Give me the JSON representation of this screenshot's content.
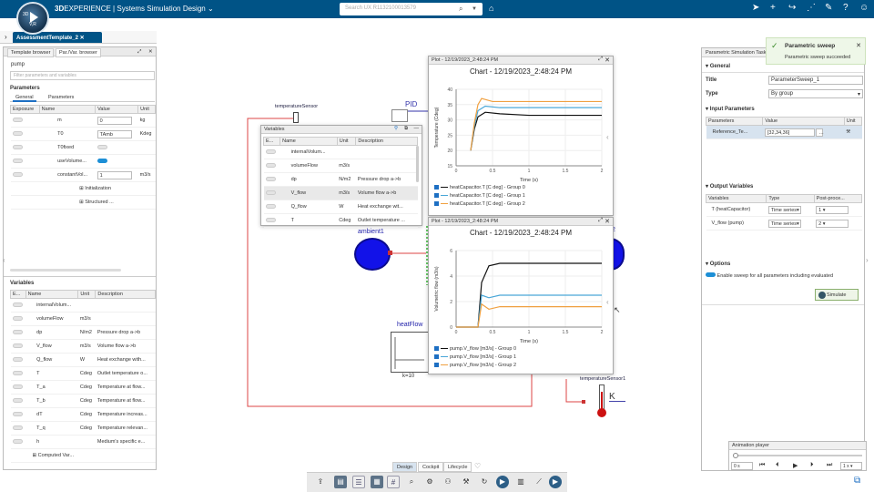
{
  "topbar": {
    "brand_bold": "3D",
    "brand_exp": "EXPERIENCE",
    "brand_sep": "|",
    "app": "Systems Simulation Design",
    "search_placeholder": "Search UX R1132100013579",
    "compass_label": "V,R"
  },
  "tabs": {
    "active": "AssessmentTemplate_2"
  },
  "left": {
    "tabs": [
      "Template browser",
      "Par./Var. browser"
    ],
    "object": "pump",
    "filter_placeholder": "Filter parameters and variables",
    "params_title": "Parameters",
    "subtabs": [
      "General",
      "Parameters"
    ],
    "param_headers": [
      "Exposure",
      "Name",
      "Value",
      "Unit"
    ],
    "params": [
      {
        "name": "m",
        "value": "0",
        "unit": "kg",
        "on": false
      },
      {
        "name": "T0",
        "value": "TAmb",
        "unit": "Kdeg",
        "on": false
      },
      {
        "name": "T0fixed",
        "value": "",
        "unit": "",
        "on": false
      },
      {
        "name": "useVolume...",
        "value": "",
        "unit": "",
        "on": true
      },
      {
        "name": "constantVol...",
        "value": "1",
        "unit": "m3/s",
        "on": false
      }
    ],
    "groups": [
      "Initialization",
      "Structured ..."
    ],
    "vars_title": "Variables",
    "var_headers": [
      "E...",
      "Name",
      "Unit",
      "Description"
    ],
    "vars": [
      {
        "name": "internalVolum...",
        "unit": "",
        "desc": ""
      },
      {
        "name": "volumeFlow",
        "unit": "m3/s",
        "desc": ""
      },
      {
        "name": "dp",
        "unit": "N/m2",
        "desc": "Pressure drop a->b"
      },
      {
        "name": "V_flow",
        "unit": "m3/s",
        "desc": "Volume flow a->b"
      },
      {
        "name": "Q_flow",
        "unit": "W",
        "desc": "Heat exchange with..."
      },
      {
        "name": "T",
        "unit": "Cdeg",
        "desc": "Outlet temperature o..."
      },
      {
        "name": "T_a",
        "unit": "Cdeg",
        "desc": "Temperature at flow..."
      },
      {
        "name": "T_b",
        "unit": "Cdeg",
        "desc": "Temperature at flow..."
      },
      {
        "name": "dT",
        "unit": "Cdeg",
        "desc": "Temperature increas..."
      },
      {
        "name": "T_q",
        "unit": "Cdeg",
        "desc": "Temperature relevan..."
      },
      {
        "name": "h",
        "unit": "",
        "desc": "Medium's specific e..."
      }
    ],
    "computed": "Computed Var..."
  },
  "canvas": {
    "tempSensor": "temperatureSensor",
    "pid": "PID",
    "ambient": "ambient1",
    "ambient2": "t2",
    "heatflow": "heatFlow",
    "k": "k=10",
    "tempSensor1": "temperatureSensor1",
    "kunit": "K"
  },
  "vars_popup": {
    "title": "Variables",
    "headers": [
      "E...",
      "Name",
      "Unit",
      "Description"
    ],
    "rows": [
      {
        "name": "internalVolum...",
        "unit": "",
        "desc": ""
      },
      {
        "name": "volumeFlow",
        "unit": "m3/s",
        "desc": ""
      },
      {
        "name": "dp",
        "unit": "N/m2",
        "desc": "Pressure drop a->b"
      },
      {
        "name": "V_flow",
        "unit": "m3/s",
        "desc": "Volume flow a->b"
      },
      {
        "name": "Q_flow",
        "unit": "W",
        "desc": "Heat exchange wit..."
      },
      {
        "name": "T",
        "unit": "Cdeg",
        "desc": "Outlet temperature ..."
      }
    ]
  },
  "plot1": {
    "wtitle": "Plot - 12/19/2023_2:48:24 PM",
    "legend": [
      "heatCapacitor.T [C deg] - Group 0",
      "heatCapacitor.T [C deg] - Group 1",
      "heatCapacitor.T [C deg] - Group 2"
    ]
  },
  "plot2": {
    "wtitle": "Plot - 12/19/2023_2:48:24 PM",
    "legend": [
      "pump.V_flow [m3/s] - Group 0",
      "pump.V_flow [m3/s] - Group 1",
      "pump.V_flow [m3/s] - Group 2"
    ]
  },
  "chart_data": [
    {
      "type": "line",
      "title": "Chart - 12/19/2023_2:48:24 PM",
      "xlabel": "Time (s)",
      "ylabel": "Temperature (Cdeg)",
      "xlim": [
        0,
        2
      ],
      "ylim": [
        15,
        40
      ],
      "xticks": [
        "0",
        "0.5",
        "1",
        "1.5",
        "2"
      ],
      "yticks": [
        "15",
        "20",
        "25",
        "30",
        "35",
        "40"
      ],
      "series": [
        {
          "name": "heatCapacitor.T [C deg] - Group 0",
          "color": "#111111",
          "x": [
            0.2,
            0.25,
            0.3,
            0.4,
            0.6,
            1,
            2
          ],
          "y": [
            20,
            27,
            31,
            32.5,
            32,
            31.5,
            31.5
          ]
        },
        {
          "name": "heatCapacitor.T [C deg] - Group 1",
          "color": "#4aa7d8",
          "x": [
            0.2,
            0.25,
            0.3,
            0.4,
            0.6,
            1,
            2
          ],
          "y": [
            20,
            28,
            33,
            34.5,
            34,
            34,
            34
          ]
        },
        {
          "name": "heatCapacitor.T [C deg] - Group 2",
          "color": "#f0a040",
          "x": [
            0.2,
            0.25,
            0.3,
            0.35,
            0.5,
            1,
            2
          ],
          "y": [
            20,
            29,
            35,
            37,
            36,
            36,
            36
          ]
        }
      ]
    },
    {
      "type": "line",
      "title": "Chart - 12/19/2023_2:48:24 PM",
      "xlabel": "Time (s)",
      "ylabel": "Volumetric flow (m3/s)",
      "xlim": [
        0,
        2
      ],
      "ylim": [
        0,
        6
      ],
      "xticks": [
        "0",
        "0.5",
        "1",
        "1.5",
        "2"
      ],
      "yticks": [
        "0",
        "2",
        "4",
        "6"
      ],
      "series": [
        {
          "name": "pump.V_flow [m3/s] - Group 0",
          "color": "#111111",
          "x": [
            0,
            0.3,
            0.35,
            0.45,
            0.6,
            1,
            2
          ],
          "y": [
            0,
            0,
            3.5,
            4.8,
            5,
            5,
            5
          ]
        },
        {
          "name": "pump.V_flow [m3/s] - Group 1",
          "color": "#4aa7d8",
          "x": [
            0,
            0.3,
            0.35,
            0.45,
            0.6,
            1,
            2
          ],
          "y": [
            0,
            0,
            2.5,
            2.3,
            2.5,
            2.5,
            2.5
          ]
        },
        {
          "name": "pump.V_flow [m3/s] - Group 2",
          "color": "#f0a040",
          "x": [
            0,
            0.3,
            0.35,
            0.45,
            0.6,
            1,
            2
          ],
          "y": [
            0,
            0,
            1.8,
            1.4,
            1.6,
            1.6,
            1.6
          ]
        }
      ]
    }
  ],
  "right": {
    "title": "Parametric Simulation Task",
    "general": "General",
    "title_lbl": "Title",
    "title_val": "ParameterSweep_1",
    "type_lbl": "Type",
    "type_val": "By group",
    "inputs": "Input Parameters",
    "in_headers": [
      "Parameters",
      "Value",
      "Unit"
    ],
    "in_row": {
      "p": "Reference_Te...",
      "v": "[32,34,36]"
    },
    "outputs": "Output Variables",
    "out_headers": [
      "Variables",
      "Type",
      "Post-proce..."
    ],
    "out_rows": [
      {
        "v": "T (heatCapacitor)",
        "t": "Time series",
        "p": "1"
      },
      {
        "v": "V_flow (pump)",
        "t": "Time series",
        "p": "2"
      }
    ],
    "options": "Options",
    "opt_text": "Enable sweep for all parameters including evaluated",
    "simulate": "Simulate"
  },
  "notif": {
    "title": "Parametric sweep",
    "msg": "Parametric sweep succeeded"
  },
  "anim": {
    "title": "Animation player",
    "time": "0 s",
    "speed": "1 x"
  },
  "bottom_tabs": [
    "Design",
    "Cockpit",
    "Lifecycle"
  ]
}
